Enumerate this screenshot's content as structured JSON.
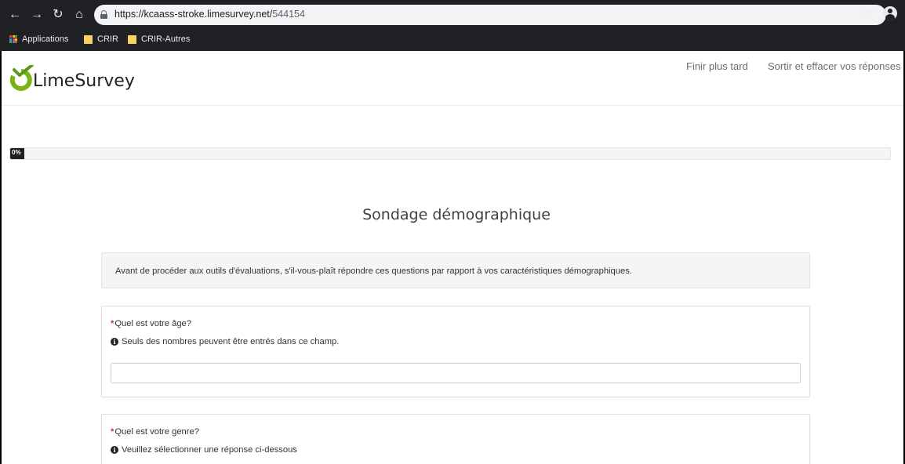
{
  "browser": {
    "url_host": "https://kcaass-stroke.limesurvey.net/",
    "url_path": "544154",
    "bookmarks": [
      {
        "label": "Applications"
      },
      {
        "label": "CRIR"
      },
      {
        "label": "CRIR-Autres"
      }
    ]
  },
  "header": {
    "logo_text": "LimeSurvey",
    "links": [
      "Finir plus tard",
      "Sortir et effacer vos réponses"
    ]
  },
  "progress": {
    "label": "0%",
    "value": 0
  },
  "survey": {
    "title": "Sondage démographique",
    "description": "Avant de procéder aux outils d'évaluations, s'il-vous-plaît répondre ces questions par rapport à vos caractéristiques démographiques."
  },
  "questions": [
    {
      "mandatory": "*",
      "text": "Quel est votre âge?",
      "tip": "Seuls des nombres peuvent être entrés dans ce champ.",
      "value": ""
    },
    {
      "mandatory": "*",
      "text": "Quel est votre genre?",
      "tip": "Veuillez sélectionner une réponse ci-dessous"
    }
  ],
  "colors": {
    "brand_green": "#7ab317",
    "chrome_dark": "#202124",
    "mandatory_red": "#c0392b"
  }
}
